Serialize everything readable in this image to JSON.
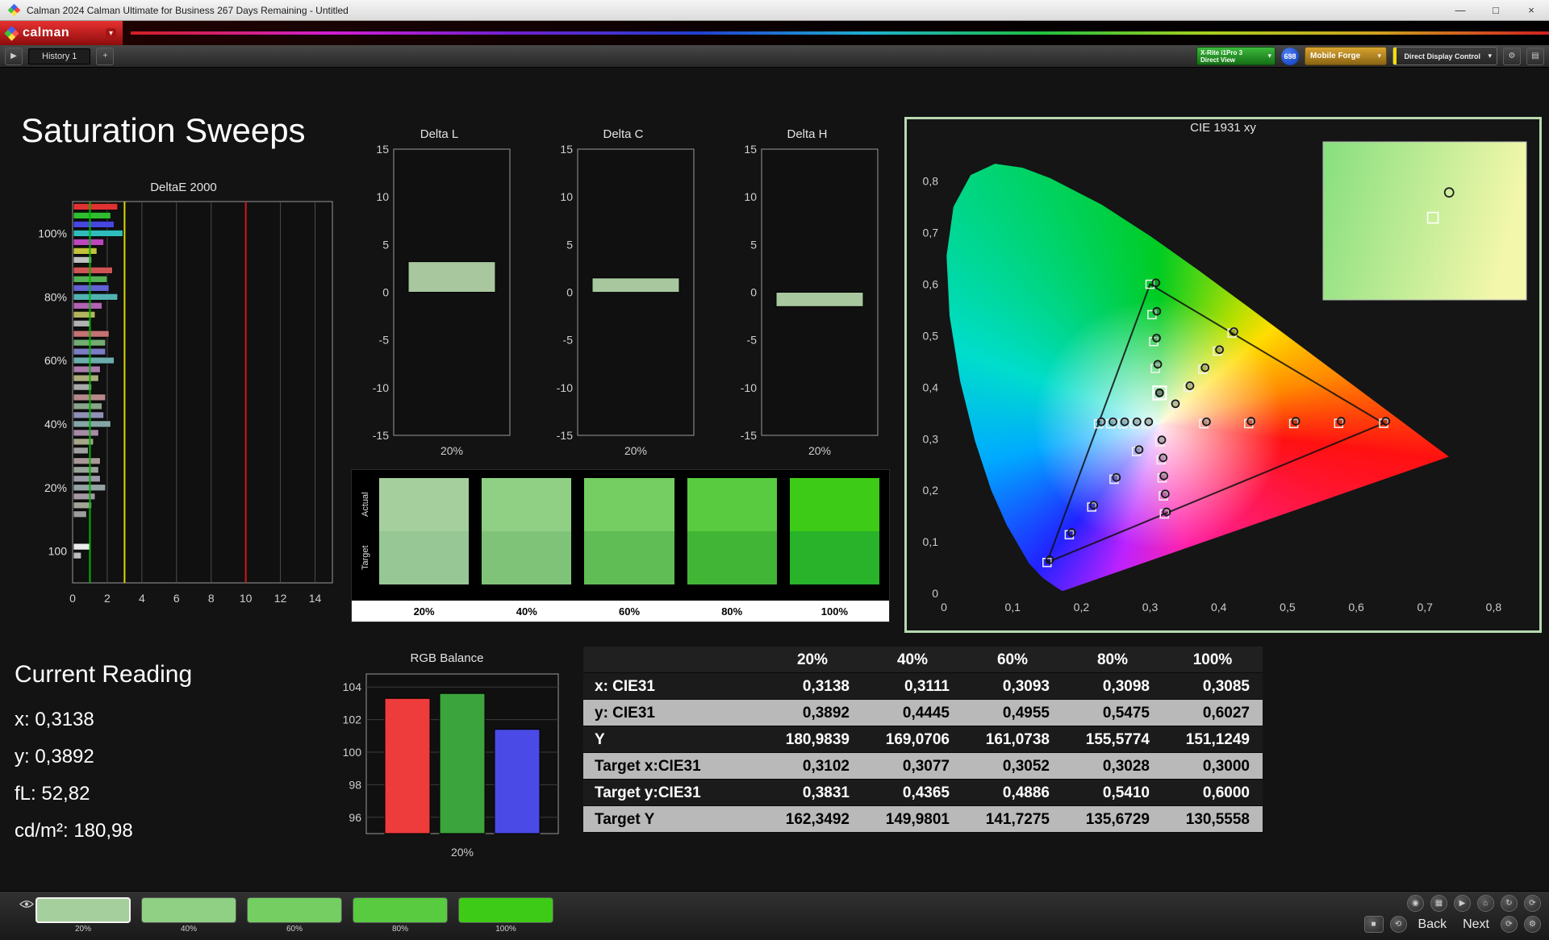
{
  "window": {
    "title": "Calman 2024 Calman Ultimate for Business 267 Days Remaining  - Untitled",
    "brand": "calman"
  },
  "icons": {
    "caret": "▾",
    "gear": "⚙",
    "layout": "▤",
    "plus": "+",
    "expand": "▶",
    "minimize": "—",
    "maximize": "□",
    "close": "×",
    "record": "◉",
    "grid": "▦",
    "play": "▶",
    "home": "⌂",
    "refresh": "↻",
    "loop_left": "⟲",
    "loop_right": "⟳",
    "stop": "■"
  },
  "toolbar": {
    "history_tab": "History 1",
    "meter_button": {
      "line1": "X-Rite i1Pro 3",
      "line2": "Direct View"
    },
    "meter_count": "698",
    "source_button": "Mobile Forge",
    "display_button": "Direct Display Control"
  },
  "page": {
    "title": "Saturation Sweeps",
    "current_reading": {
      "heading": "Current Reading",
      "lines": [
        "x: 0,3138",
        "y: 0,3892",
        "fL: 52,82",
        "cd/m²: 180,98"
      ]
    }
  },
  "footer": {
    "back_label": "Back",
    "next_label": "Next",
    "thumbnails": [
      {
        "label": "20%",
        "color": "#a6cf9e",
        "selected": true
      },
      {
        "label": "40%",
        "color": "#8fd084, #8fd084",
        "selected": false
      },
      {
        "label": "60%",
        "color": "#74ce62",
        "selected": false
      },
      {
        "label": "80%",
        "color": "#58cb41",
        "selected": false
      },
      {
        "label": "100%",
        "color": "#3ecb17",
        "selected": false
      }
    ]
  },
  "chart_data": [
    {
      "type": "bar",
      "orientation": "horizontal",
      "title": "DeltaE 2000",
      "xlim": [
        0,
        15
      ],
      "xticks": [
        0,
        2,
        4,
        6,
        8,
        10,
        12,
        14
      ],
      "reference_lines": [
        {
          "value": 1,
          "color": "#00b400"
        },
        {
          "value": 3,
          "color": "#d8d800"
        },
        {
          "value": 10,
          "color": "#d01818"
        }
      ],
      "groups": [
        {
          "label": "100%",
          "bars": [
            {
              "color": "#e03232",
              "value": 2.6
            },
            {
              "color": "#2fbe2f",
              "value": 2.2
            },
            {
              "color": "#4646e0",
              "value": 2.4
            },
            {
              "color": "#30bcbc",
              "value": 2.9
            },
            {
              "color": "#bc46bc",
              "value": 1.8
            },
            {
              "color": "#c2c23c",
              "value": 1.4
            },
            {
              "color": "#c0c0c0",
              "value": 1.1
            }
          ]
        },
        {
          "label": "80%",
          "bars": [
            {
              "color": "#d05454",
              "value": 2.3
            },
            {
              "color": "#54b254",
              "value": 2.0
            },
            {
              "color": "#6262d2",
              "value": 2.1
            },
            {
              "color": "#52b2b2",
              "value": 2.6
            },
            {
              "color": "#b262b2",
              "value": 1.7
            },
            {
              "color": "#b4b45e",
              "value": 1.3
            },
            {
              "color": "#b2b2b2",
              "value": 1.0
            }
          ]
        },
        {
          "label": "60%",
          "bars": [
            {
              "color": "#c47272",
              "value": 2.1
            },
            {
              "color": "#72ac72",
              "value": 1.9
            },
            {
              "color": "#7c7cc4",
              "value": 1.9
            },
            {
              "color": "#6cacac",
              "value": 2.4
            },
            {
              "color": "#ac7cac",
              "value": 1.6
            },
            {
              "color": "#acac7a",
              "value": 1.5
            },
            {
              "color": "#aaaaaa",
              "value": 1.1
            }
          ]
        },
        {
          "label": "40%",
          "bars": [
            {
              "color": "#b68a8a",
              "value": 1.9
            },
            {
              "color": "#8aa68a",
              "value": 1.7
            },
            {
              "color": "#9090b6",
              "value": 1.8
            },
            {
              "color": "#86a6a6",
              "value": 2.2
            },
            {
              "color": "#a68aa6",
              "value": 1.5
            },
            {
              "color": "#a6a688",
              "value": 1.2
            },
            {
              "color": "#a0a0a0",
              "value": 0.9
            }
          ]
        },
        {
          "label": "20%",
          "bars": [
            {
              "color": "#a89898",
              "value": 1.6
            },
            {
              "color": "#98a498",
              "value": 1.5
            },
            {
              "color": "#9a9aa8",
              "value": 1.6
            },
            {
              "color": "#94a4a4",
              "value": 1.9
            },
            {
              "color": "#a498a4",
              "value": 1.3
            },
            {
              "color": "#a4a496",
              "value": 1.1
            },
            {
              "color": "#9c9c9c",
              "value": 0.8
            }
          ]
        },
        {
          "label": "100",
          "bars": [
            {
              "color": "#ececec",
              "value": 1.0
            },
            {
              "color": "#bdbdbd",
              "value": 0.5
            }
          ]
        }
      ]
    },
    {
      "type": "bar",
      "title": "Delta L",
      "categories": [
        "20%"
      ],
      "values": [
        3.2
      ],
      "ylim": [
        -15,
        15
      ],
      "yticks": [
        -15,
        -10,
        -5,
        0,
        5,
        10,
        15
      ],
      "bar_color": "#a9c79f"
    },
    {
      "type": "bar",
      "title": "Delta C",
      "categories": [
        "20%"
      ],
      "values": [
        1.5
      ],
      "ylim": [
        -15,
        15
      ],
      "yticks": [
        -15,
        -10,
        -5,
        0,
        5,
        10,
        15
      ],
      "bar_color": "#a9c79f"
    },
    {
      "type": "bar",
      "title": "Delta H",
      "categories": [
        "20%"
      ],
      "values": [
        -1.5
      ],
      "ylim": [
        -15,
        15
      ],
      "yticks": [
        -15,
        -10,
        -5,
        0,
        5,
        10,
        15
      ],
      "bar_color": "#a9c79f"
    },
    {
      "type": "table",
      "title": "saturation-swatches",
      "row_labels": [
        "Actual",
        "Target"
      ],
      "columns": [
        "20%",
        "40%",
        "60%",
        "80%",
        "100%"
      ],
      "actual_colors": [
        "#a6cf9e",
        "#8fd084",
        "#74ce62",
        "#58cb41",
        "#3ecb17"
      ],
      "target_colors": [
        "#97c794",
        "#7fc379",
        "#60bd55",
        "#41b535",
        "#28b32a"
      ]
    },
    {
      "type": "scatter",
      "title": "CIE 1931 xy",
      "xlim": [
        0,
        0.85
      ],
      "ylim": [
        0,
        0.87
      ],
      "ticks": [
        0,
        0.1,
        0.2,
        0.3,
        0.4,
        0.5,
        0.6,
        0.7,
        0.8
      ],
      "tick_labels": [
        "0",
        "0,1",
        "0,2",
        "0,3",
        "0,4",
        "0,5",
        "0,6",
        "0,7",
        "0,8"
      ],
      "white_point": [
        0.3127,
        0.329
      ],
      "gamut_triangle": [
        [
          0.64,
          0.33
        ],
        [
          0.3,
          0.6
        ],
        [
          0.15,
          0.06
        ]
      ],
      "targets": [
        [
          0.3102,
          0.3831
        ],
        [
          0.3077,
          0.4365
        ],
        [
          0.3052,
          0.4886
        ],
        [
          0.3028,
          0.541
        ],
        [
          0.3,
          0.6
        ],
        [
          0.3782,
          0.3292
        ],
        [
          0.4436,
          0.3294
        ],
        [
          0.5091,
          0.3296
        ],
        [
          0.5745,
          0.3298
        ],
        [
          0.64,
          0.33
        ],
        [
          0.2802,
          0.2752
        ],
        [
          0.2476,
          0.2214
        ],
        [
          0.2151,
          0.1676
        ],
        [
          0.1825,
          0.1138
        ],
        [
          0.15,
          0.06
        ],
        [
          0.2952,
          0.329
        ],
        [
          0.2776,
          0.329
        ],
        [
          0.2601,
          0.329
        ],
        [
          0.2425,
          0.329
        ],
        [
          0.225,
          0.329
        ],
        [
          0.3143,
          0.294
        ],
        [
          0.316,
          0.2591
        ],
        [
          0.3176,
          0.2241
        ],
        [
          0.3193,
          0.1892
        ],
        [
          0.3209,
          0.1542
        ],
        [
          0.334,
          0.3643
        ],
        [
          0.3553,
          0.3995
        ],
        [
          0.3767,
          0.4348
        ],
        [
          0.398,
          0.47
        ],
        [
          0.4193,
          0.5053
        ]
      ],
      "measurements": [
        [
          0.3138,
          0.3892
        ],
        [
          0.3111,
          0.4445
        ],
        [
          0.3093,
          0.4955
        ],
        [
          0.3098,
          0.5475
        ],
        [
          0.3085,
          0.6027
        ],
        [
          0.382,
          0.333
        ],
        [
          0.447,
          0.334
        ],
        [
          0.512,
          0.334
        ],
        [
          0.578,
          0.334
        ],
        [
          0.643,
          0.334
        ],
        [
          0.284,
          0.279
        ],
        [
          0.251,
          0.225
        ],
        [
          0.218,
          0.171
        ],
        [
          0.186,
          0.118
        ],
        [
          0.154,
          0.065
        ],
        [
          0.298,
          0.333
        ],
        [
          0.281,
          0.333
        ],
        [
          0.263,
          0.333
        ],
        [
          0.246,
          0.333
        ],
        [
          0.229,
          0.333
        ],
        [
          0.317,
          0.298
        ],
        [
          0.319,
          0.263
        ],
        [
          0.32,
          0.228
        ],
        [
          0.322,
          0.193
        ],
        [
          0.324,
          0.158
        ],
        [
          0.337,
          0.368
        ],
        [
          0.358,
          0.403
        ],
        [
          0.38,
          0.438
        ],
        [
          0.401,
          0.473
        ],
        [
          0.422,
          0.508
        ]
      ],
      "current": [
        0.3138,
        0.3892
      ],
      "inset": {
        "gradient": [
          "#86df7e",
          "#f3f7ab"
        ],
        "circle": [
          0.62,
          0.32
        ],
        "square": [
          0.54,
          0.48
        ]
      }
    },
    {
      "type": "bar",
      "title": "RGB Balance",
      "categories": [
        "20%"
      ],
      "ylim": [
        95,
        104.8
      ],
      "yticks": [
        96,
        98,
        100,
        102,
        104
      ],
      "series": [
        {
          "name": "Red",
          "color": "#ee3b3b",
          "value": 103.3
        },
        {
          "name": "Green",
          "color": "#3ca43c",
          "value": 103.6
        },
        {
          "name": "Blue",
          "color": "#4a4ae6",
          "value": 101.4
        }
      ]
    },
    {
      "type": "table",
      "title": "measurement-table",
      "columns": [
        "",
        "20%",
        "40%",
        "60%",
        "80%",
        "100%"
      ],
      "rows": [
        {
          "label": "x: CIE31",
          "values": [
            "0,3138",
            "0,3111",
            "0,3093",
            "0,3098",
            "0,3085"
          ]
        },
        {
          "label": "y: CIE31",
          "values": [
            "0,3892",
            "0,4445",
            "0,4955",
            "0,5475",
            "0,6027"
          ]
        },
        {
          "label": "Y",
          "values": [
            "180,9839",
            "169,0706",
            "161,0738",
            "155,5774",
            "151,1249"
          ]
        },
        {
          "label": "Target x:CIE31",
          "values": [
            "0,3102",
            "0,3077",
            "0,3052",
            "0,3028",
            "0,3000"
          ]
        },
        {
          "label": "Target y:CIE31",
          "values": [
            "0,3831",
            "0,4365",
            "0,4886",
            "0,5410",
            "0,6000"
          ]
        },
        {
          "label": "Target Y",
          "values": [
            "162,3492",
            "149,9801",
            "141,7275",
            "135,6729",
            "130,5558"
          ]
        }
      ]
    }
  ]
}
